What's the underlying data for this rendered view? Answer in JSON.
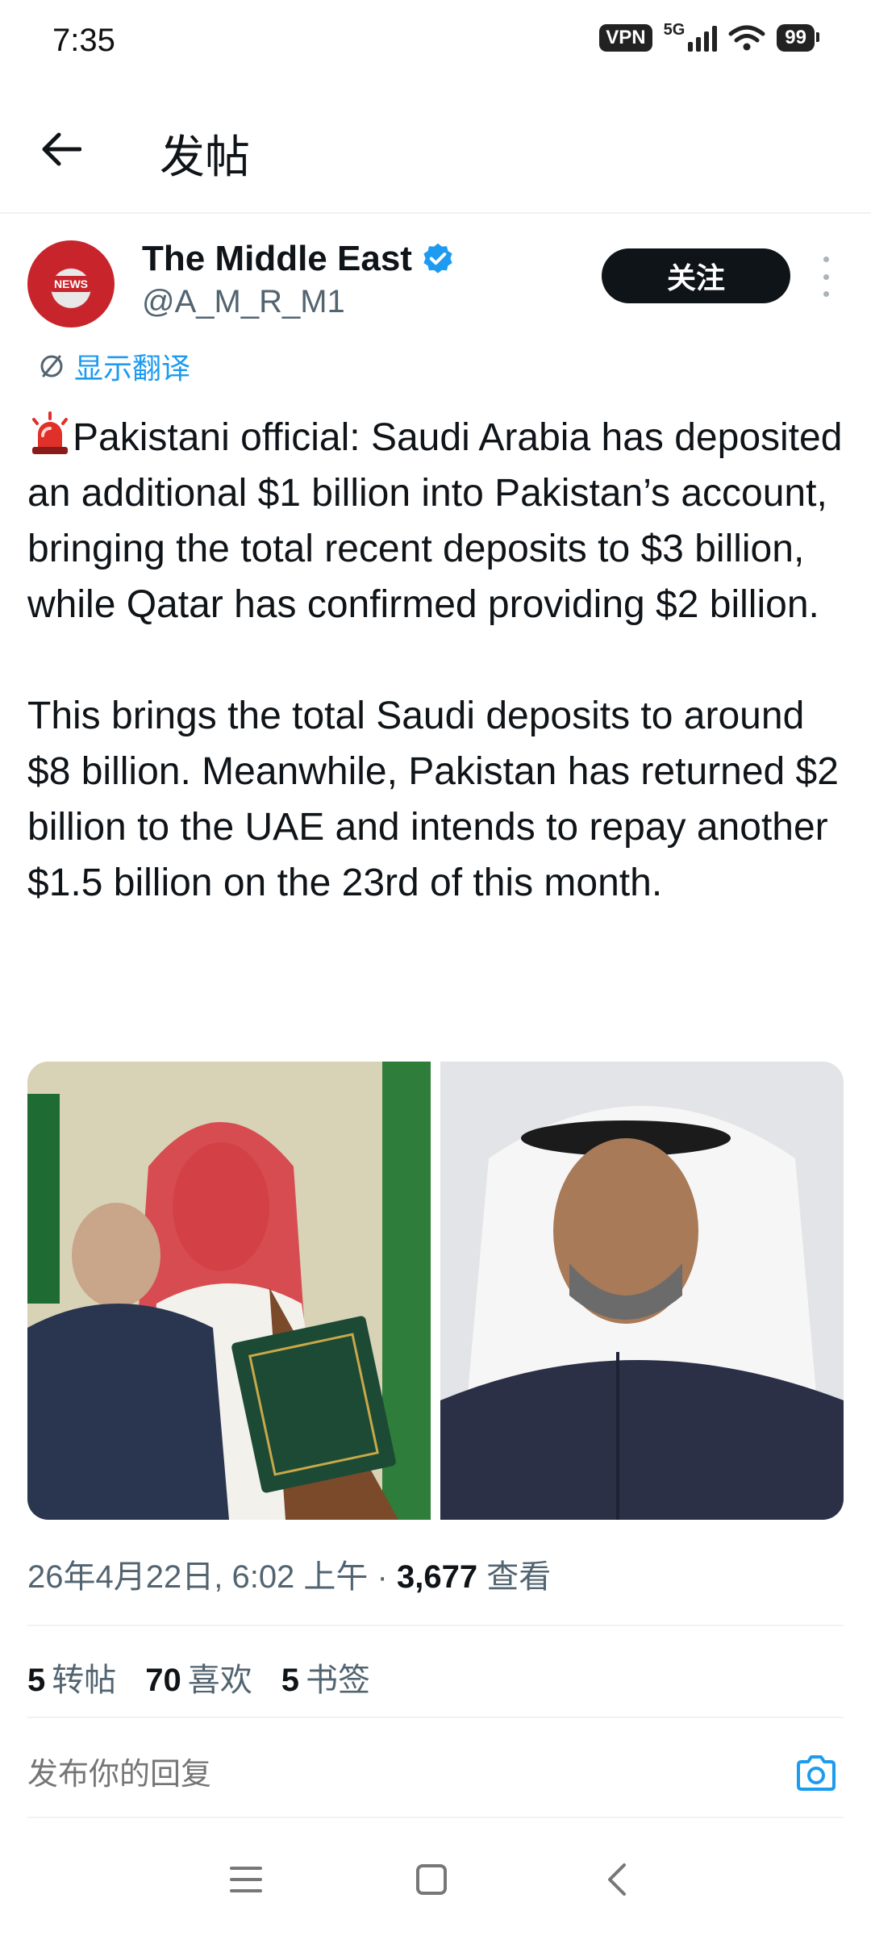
{
  "status_bar": {
    "time": "7:35",
    "vpn": "VPN",
    "network": "5G",
    "battery": "99"
  },
  "header": {
    "title": "发帖"
  },
  "author": {
    "name": "The Middle East",
    "handle": "@A_M_R_M1",
    "avatar_badge": "NEWS",
    "verified": true
  },
  "follow_label": "关注",
  "translate_label": "显示翻译",
  "post": {
    "paragraph1": "Pakistani official: Saudi Arabia has deposited an additional $1 billion into Pakistan’s account, bringing the total recent deposits to $3 billion, while Qatar has confirmed providing $2 billion.",
    "paragraph2": "This brings the total Saudi deposits to around $8 billion. Meanwhile, Pakistan has returned $2 billion to the UAE and intends to repay another $1.5 billion on the 23rd of this month."
  },
  "meta": {
    "datetime": "26年4月22日, 6:02 上午 · ",
    "views_count": "3,677",
    "views_label": " 查看"
  },
  "stats": [
    {
      "count": "5",
      "label": "转帖"
    },
    {
      "count": "70",
      "label": "喜欢"
    },
    {
      "count": "5",
      "label": "书签"
    }
  ],
  "reply": {
    "placeholder": "发布你的回复"
  },
  "colors": {
    "accent": "#1d9bf0",
    "text": "#0f1419",
    "secondary": "#536471"
  },
  "icons": [
    "back-arrow-icon",
    "verified-icon",
    "more-icon",
    "translate-icon",
    "siren-icon",
    "camera-icon",
    "menu-icon",
    "home-icon",
    "nav-back-icon"
  ]
}
